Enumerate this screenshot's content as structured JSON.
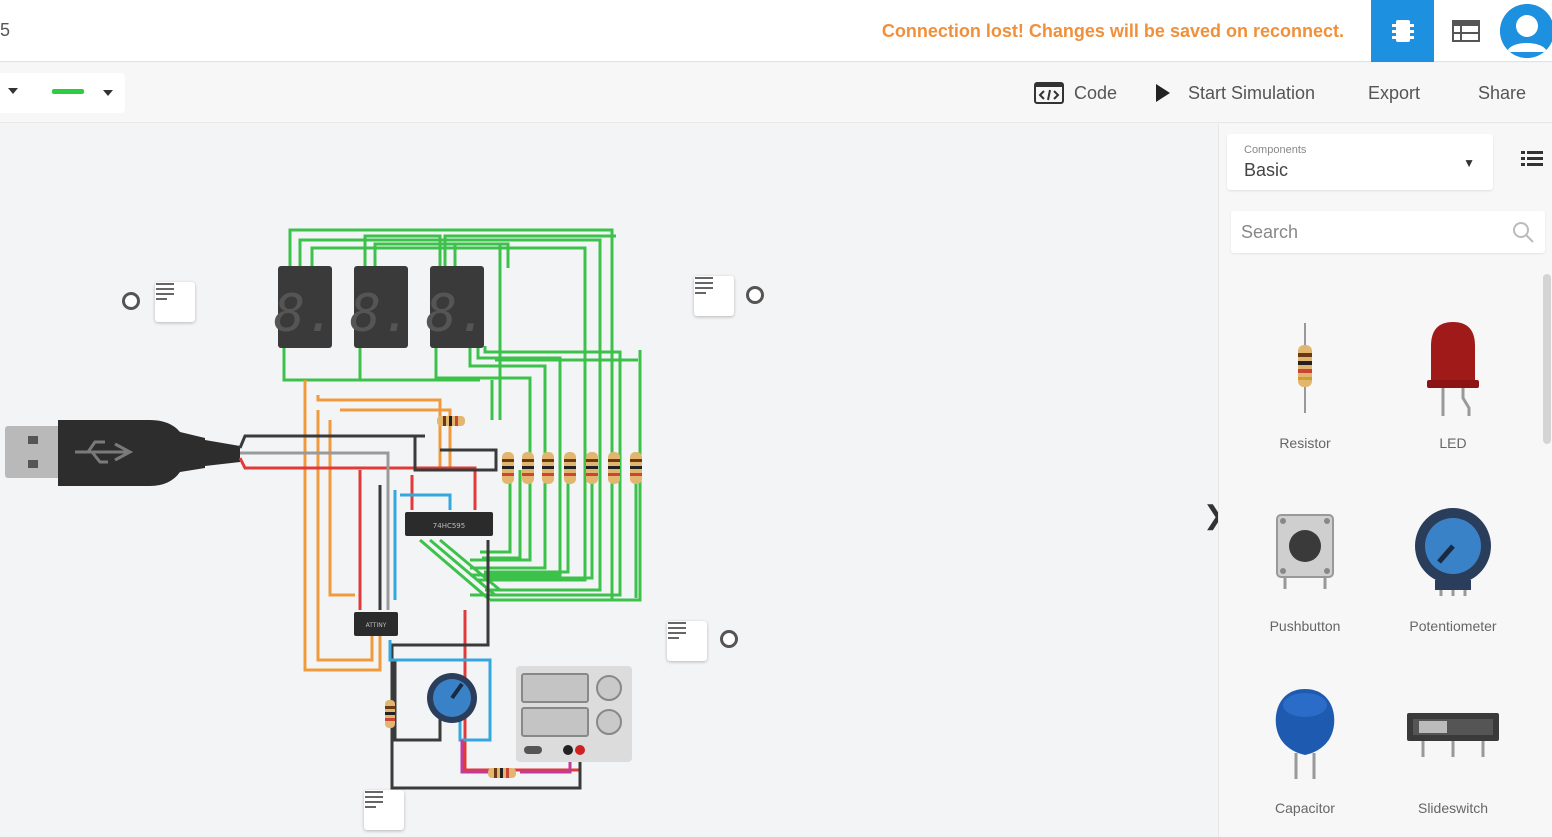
{
  "header": {
    "title_fragment": "5",
    "status_message": "Connection lost! Changes will be saved on reconnect.",
    "status_color": "#f0903a",
    "accent_color": "#1e90e0",
    "circuit_view_icon": "breadboard-chip-icon",
    "schematic_view_icon": "schematic-table-icon",
    "avatar_icon": "user-avatar-icon"
  },
  "toolbar": {
    "wire_color": "#2ecc40",
    "code_label": "Code",
    "start_simulation_label": "Start Simulation",
    "export_label": "Export",
    "share_label": "Share"
  },
  "panel": {
    "components_label": "Components",
    "components_value": "Basic",
    "search_placeholder": "Search",
    "items": [
      {
        "label": "Resistor",
        "icon": "resistor-icon"
      },
      {
        "label": "LED",
        "icon": "led-icon"
      },
      {
        "label": "Pushbutton",
        "icon": "pushbutton-icon"
      },
      {
        "label": "Potentiometer",
        "icon": "potentiometer-icon"
      },
      {
        "label": "Capacitor",
        "icon": "capacitor-icon"
      },
      {
        "label": "Slideswitch",
        "icon": "slideswitch-icon"
      }
    ]
  },
  "canvas": {
    "display_digits": [
      "8.",
      "8.",
      "8."
    ],
    "chip_labels": [
      "74HC595",
      "ATTINY"
    ]
  }
}
